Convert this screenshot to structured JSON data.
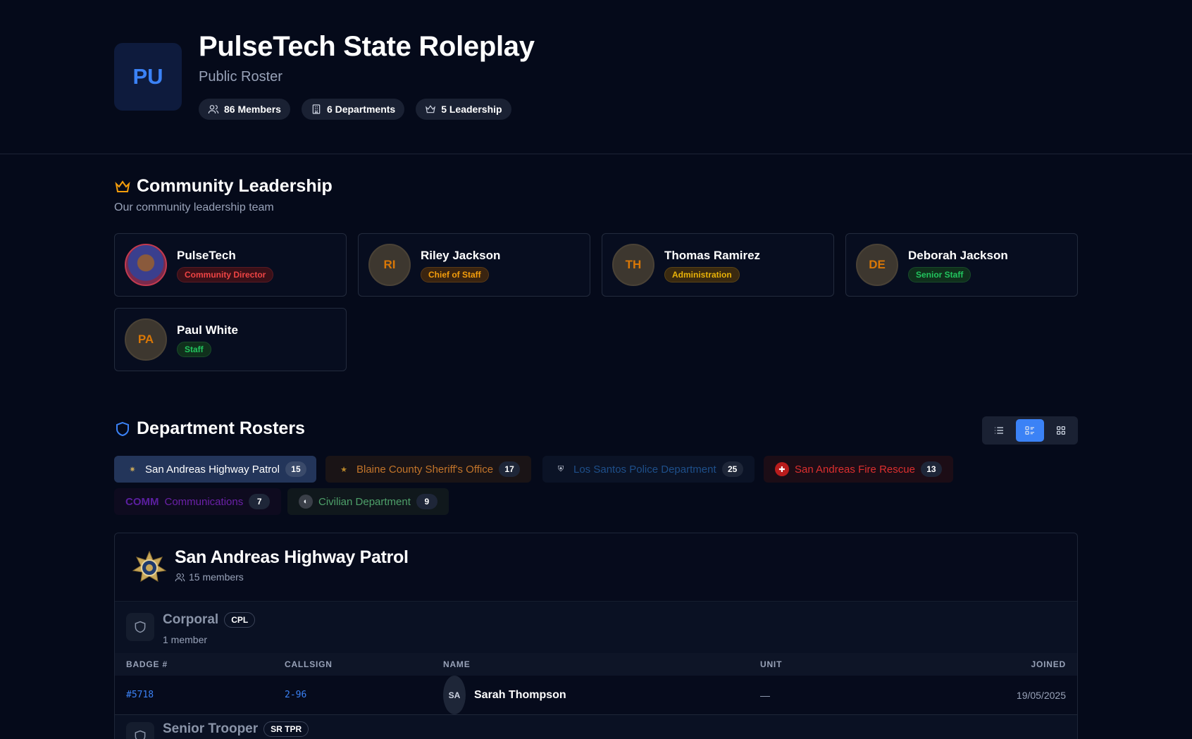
{
  "header": {
    "logo_initials": "PU",
    "title": "PulseTech State Roleplay",
    "subtitle": "Public Roster",
    "stats": [
      {
        "icon": "users-icon",
        "label": "86 Members"
      },
      {
        "icon": "building-icon",
        "label": "6 Departments"
      },
      {
        "icon": "crown-icon",
        "label": "5 Leadership"
      }
    ]
  },
  "leadership": {
    "title": "Community Leadership",
    "subtitle": "Our community leadership team",
    "members": [
      {
        "name": "PulseTech",
        "initials": "",
        "role": "Community Director",
        "role_color": "#ef4444"
      },
      {
        "name": "Riley Jackson",
        "initials": "RI",
        "role": "Chief of Staff",
        "role_color": "#f59e0b"
      },
      {
        "name": "Thomas Ramirez",
        "initials": "TH",
        "role": "Administration",
        "role_color": "#eab308"
      },
      {
        "name": "Deborah Jackson",
        "initials": "DE",
        "role": "Senior Staff",
        "role_color": "#22c55e"
      },
      {
        "name": "Paul White",
        "initials": "PA",
        "role": "Staff",
        "role_color": "#22c55e"
      }
    ]
  },
  "departments": {
    "title": "Department Rosters",
    "view_modes": [
      "list-view-icon",
      "detailed-view-icon",
      "grid-view-icon"
    ],
    "active_view": "detailed-view-icon",
    "tabs": [
      {
        "label": "San Andreas Highway Patrol",
        "count": "15",
        "color": "#ffffff",
        "active": true
      },
      {
        "label": "Blaine County Sheriff's Office",
        "count": "17",
        "color": "#c2742a"
      },
      {
        "label": "Los Santos Police Department",
        "count": "25",
        "color": "#1e4f8a"
      },
      {
        "label": "San Andreas Fire Rescue",
        "count": "13",
        "color": "#dc2f2f"
      },
      {
        "label": "Communications",
        "prefix": "COMM",
        "count": "7",
        "color": "#6b21a8"
      },
      {
        "label": "Civilian Department",
        "count": "9",
        "color": "#4ea06a"
      }
    ]
  },
  "roster": {
    "title": "San Andreas Highway Patrol",
    "members_label": "15 members",
    "columns": [
      "BADGE #",
      "CALLSIGN",
      "NAME",
      "UNIT",
      "JOINED"
    ],
    "ranks": [
      {
        "name": "Corporal",
        "abbr": "CPL",
        "count_label": "1 member",
        "rows": [
          {
            "badge": "#5718",
            "callsign": "2-96",
            "initials": "SA",
            "name": "Sarah Thompson",
            "unit": "—",
            "joined": "19/05/2025"
          }
        ]
      },
      {
        "name": "Senior Trooper",
        "abbr": "SR TPR"
      }
    ]
  }
}
